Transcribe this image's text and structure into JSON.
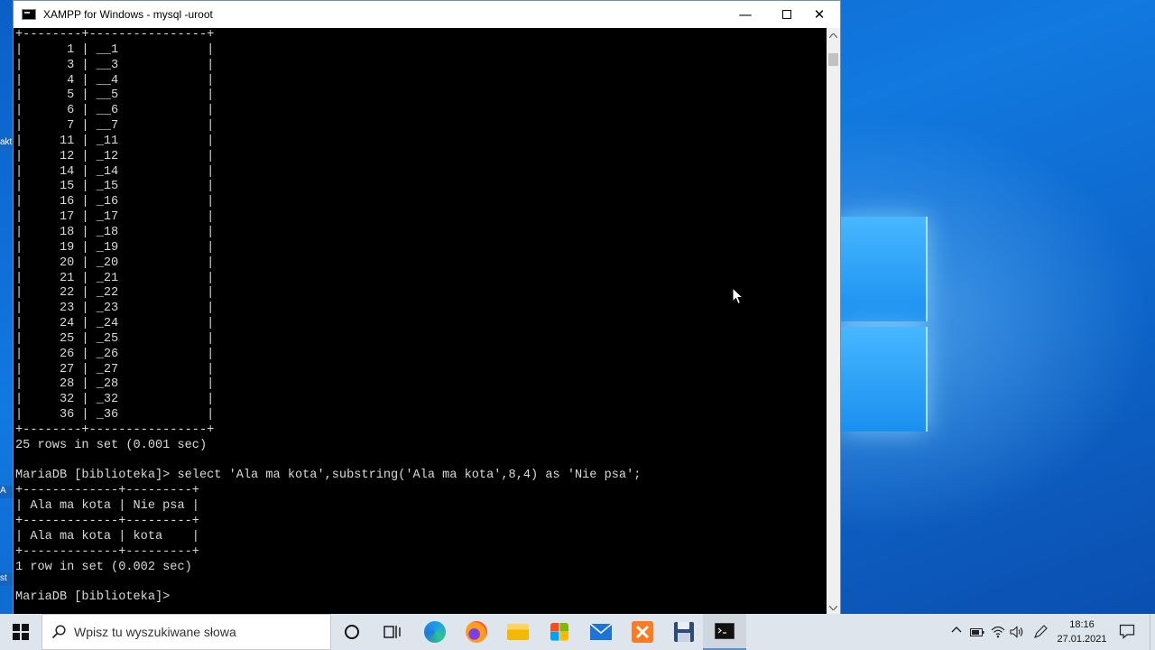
{
  "window": {
    "title": "XAMPP for Windows - mysql  -uroot",
    "minimize_glyph": "—",
    "close_glyph": "✕"
  },
  "terminal": {
    "text": "+--------+----------------+\n|      1 | __1            |\n|      3 | __3            |\n|      4 | __4            |\n|      5 | __5            |\n|      6 | __6            |\n|      7 | __7            |\n|     11 | _11            |\n|     12 | _12            |\n|     14 | _14            |\n|     15 | _15            |\n|     16 | _16            |\n|     17 | _17            |\n|     18 | _18            |\n|     19 | _19            |\n|     20 | _20            |\n|     21 | _21            |\n|     22 | _22            |\n|     23 | _23            |\n|     24 | _24            |\n|     25 | _25            |\n|     26 | _26            |\n|     27 | _27            |\n|     28 | _28            |\n|     32 | _32            |\n|     36 | _36            |\n+--------+----------------+\n25 rows in set (0.001 sec)\n\nMariaDB [biblioteka]> select 'Ala ma kota',substring('Ala ma kota',8,4) as 'Nie psa';\n+-------------+---------+\n| Ala ma kota | Nie psa |\n+-------------+---------+\n| Ala ma kota | kota    |\n+-------------+---------+\n1 row in set (0.002 sec)\n\nMariaDB [biblioteka]> "
  },
  "desktop": {
    "side_labels": [
      "akt",
      "A",
      "st"
    ]
  },
  "taskbar": {
    "search_placeholder": "Wpisz tu wyszukiwane słowa",
    "apps": [
      "task-view",
      "edge",
      "firefox",
      "file-explorer",
      "store",
      "mail",
      "xampp",
      "save-disk",
      "command-prompt"
    ],
    "active_app": "command-prompt"
  },
  "tray": {
    "time": "18:16",
    "date": "27.01.2021"
  },
  "colors": {
    "terminal_bg": "#000000",
    "terminal_fg": "#d9d9d9",
    "desktop_blue": "#0b5fc6",
    "taskbar_bg": "#dfe5ec"
  }
}
